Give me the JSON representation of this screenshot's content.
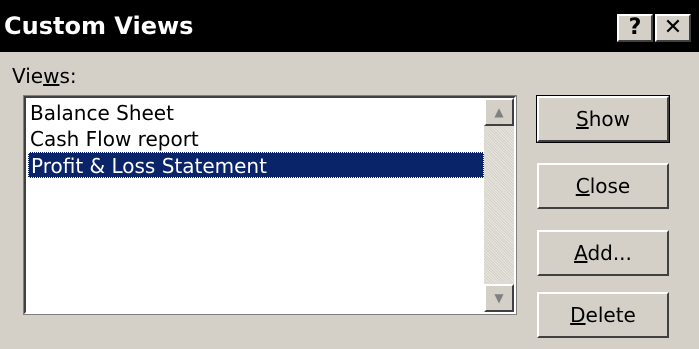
{
  "window": {
    "title": "Custom Views",
    "help_glyph": "?",
    "close_glyph": "✕"
  },
  "views_label": {
    "pre": "Vie",
    "accel": "w",
    "post": "s:"
  },
  "views": [
    {
      "label": "Balance Sheet",
      "selected": false
    },
    {
      "label": "Cash Flow report",
      "selected": false
    },
    {
      "label": "Profit & Loss Statement",
      "selected": true
    }
  ],
  "scrollbar": {
    "up_glyph": "▲",
    "down_glyph": "▼"
  },
  "buttons": {
    "show": {
      "accel": "S",
      "rest": "how"
    },
    "close": {
      "accel": "C",
      "rest": "lose"
    },
    "add": {
      "accel": "A",
      "rest": "dd..."
    },
    "delete": {
      "accel": "D",
      "rest": "elete"
    }
  },
  "colors": {
    "dialog_bg": "#d4d0c8",
    "titlebar_bg": "#000000",
    "selection_bg": "#0a246a",
    "selection_text": "#ffffff"
  }
}
